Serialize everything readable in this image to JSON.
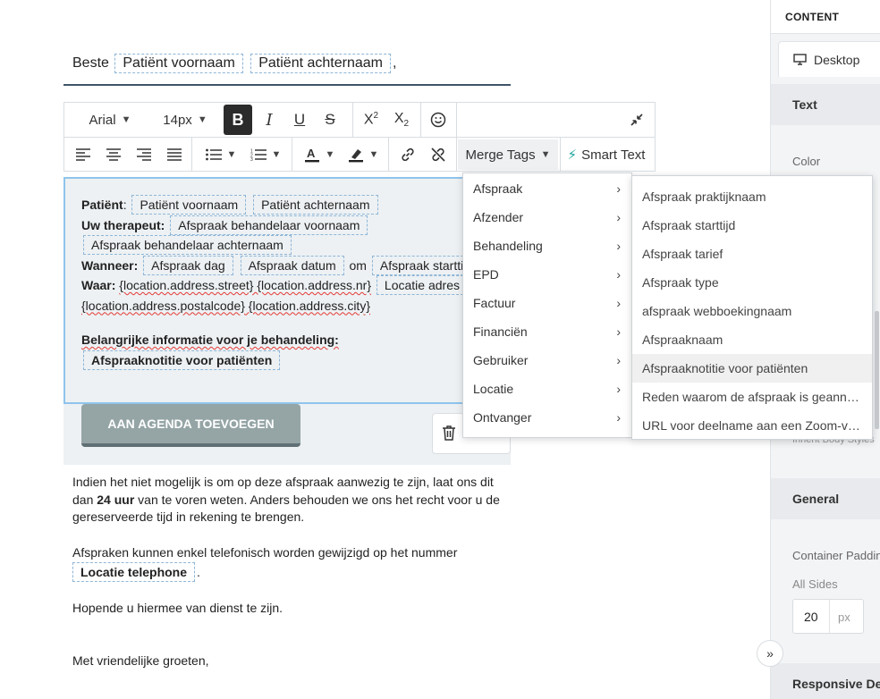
{
  "greeting": {
    "prefix": "Beste",
    "tag1": "Patiënt voornaam",
    "tag2": "Patiënt achternaam",
    "suffix": ","
  },
  "toolbar": {
    "font_family": "Arial",
    "font_size": "14px",
    "bold": "B",
    "italic": "I",
    "underline": "U",
    "strike": "S",
    "merge_tags_label": "Merge Tags",
    "smart_text_label": "Smart Text"
  },
  "editor": {
    "patient_label": "Patiënt",
    "patient_tag1": "Patiënt voornaam",
    "patient_tag2": "Patiënt achternaam",
    "therapist_label": "Uw therapeut:",
    "therapist_tag1": "Afspraak behandelaar voornaam",
    "therapist_tag2": "Afspraak behandelaar achternaam",
    "when_label": "Wanneer:",
    "when_tag1": "Afspraak dag",
    "when_tag2": "Afspraak datum",
    "when_om": "om",
    "when_tag3": "Afspraak starttijd",
    "where_label": "Waar:",
    "where_text": "{location.address.street} {location.address.nr}",
    "where_tag": "Locatie adres",
    "where_line2": "{location.address.postalcode} {location.address.city}",
    "important_label": "Belangrijke informatie voor je behandeling:",
    "important_tag": "Afspraaknotitie voor patiënten"
  },
  "agenda_button": "AAN AGENDA TOEVOEGEN",
  "body": {
    "para1_a": "Indien het niet mogelijk is om op deze afspraak aanwezig te zijn, laat ons dit",
    "para1_b": "dan",
    "para1_bold": "24 uur",
    "para1_c": "van te voren weten. Anders behouden we ons het recht voor u de",
    "para1_d": "gereserveerde tijd in rekening te brengen.",
    "para2": "Afspraken kunnen enkel telefonisch worden gewijzigd op het nummer",
    "para2_tag": "Locatie telephone",
    "para2_end": ".",
    "para3": "Hopende u hiermee van dienst te zijn.",
    "closing": "Met vriendelijke groeten,"
  },
  "merge_menu": {
    "items": [
      "Afspraak",
      "Afzender",
      "Behandeling",
      "EPD",
      "Factuur",
      "Financiën",
      "Gebruiker",
      "Locatie",
      "Ontvanger"
    ]
  },
  "submenu": {
    "items": [
      "Afspraak praktijknaam",
      "Afspraak starttijd",
      "Afspraak tarief",
      "Afspraak type",
      "afspraak webboekingnaam",
      "Afspraaknaam",
      "Afspraaknotitie voor patiënten",
      "Reden waarom de afspraak is geannuleerd",
      "URL voor deelname aan een Zoom-vergadering"
    ],
    "highlighted_index": 6
  },
  "sidebar": {
    "header": "CONTENT",
    "tab_desktop": "Desktop",
    "section_text": "Text",
    "color_label": "Color",
    "partial_text": "Inherit Body Styles",
    "section_general": "General",
    "padding_label": "Container Padding",
    "all_sides_label": "All Sides",
    "padding_value": "20",
    "padding_unit": "px",
    "section_responsive": "Responsive Design"
  },
  "colors": {
    "editor_bg": "#edf1f3",
    "selection_border": "#8fc4ec",
    "button_bg": "#95a5a6",
    "sidebar_bg": "#f3f4f6",
    "section_bg": "#e8eaed",
    "highlight": "#f0f0f0"
  }
}
